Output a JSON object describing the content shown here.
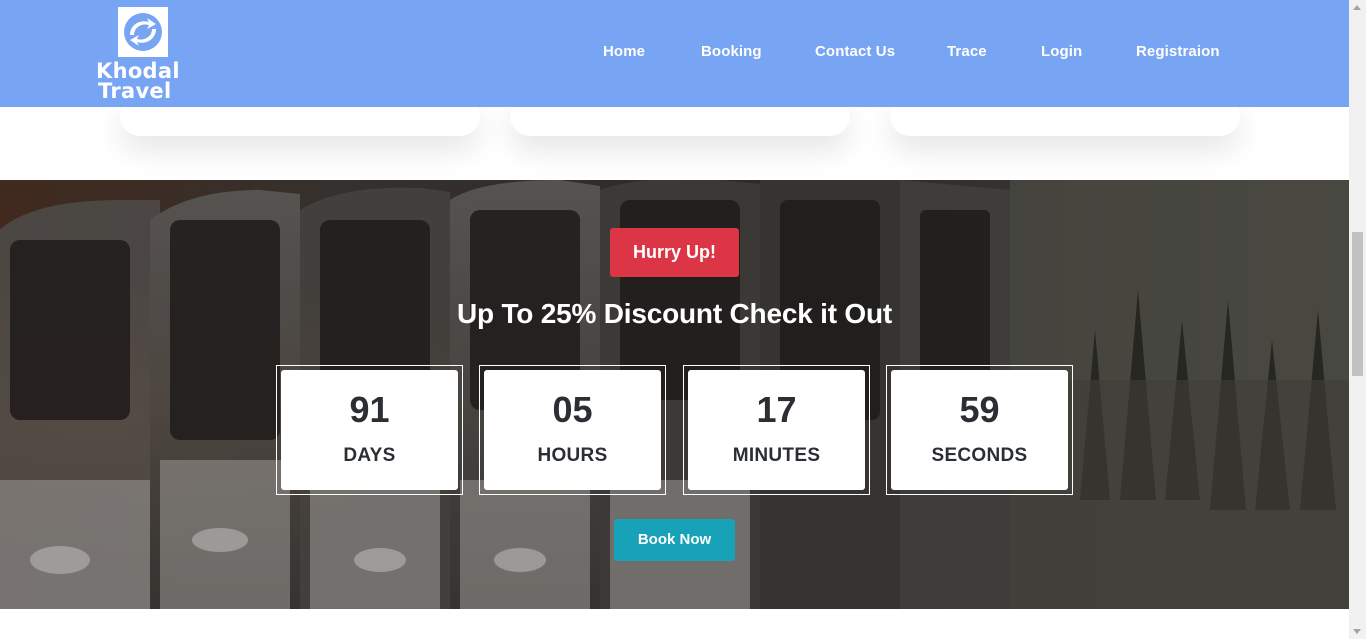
{
  "brand": {
    "name_line1": "Khodal",
    "name_line2": "Travel",
    "logo_icon": "swap-arrows-icon"
  },
  "nav": {
    "items": [
      {
        "label": "Home"
      },
      {
        "label": "Booking"
      },
      {
        "label": "Contact Us"
      },
      {
        "label": "Trace"
      },
      {
        "label": "Login"
      },
      {
        "label": "Registraion"
      }
    ]
  },
  "promo": {
    "badge": "Hurry Up!",
    "headline": "Up To 25% Discount Check it Out",
    "countdown": [
      {
        "value": "91",
        "unit": "DAYS"
      },
      {
        "value": "05",
        "unit": "HOURS"
      },
      {
        "value": "17",
        "unit": "MINUTES"
      },
      {
        "value": "59",
        "unit": "SECONDS"
      }
    ],
    "cta": "Book Now"
  },
  "colors": {
    "header_bg": "#77a4f3",
    "badge_bg": "#dc3545",
    "cta_bg": "#17a2b8",
    "text_dark": "#2b2f33"
  }
}
